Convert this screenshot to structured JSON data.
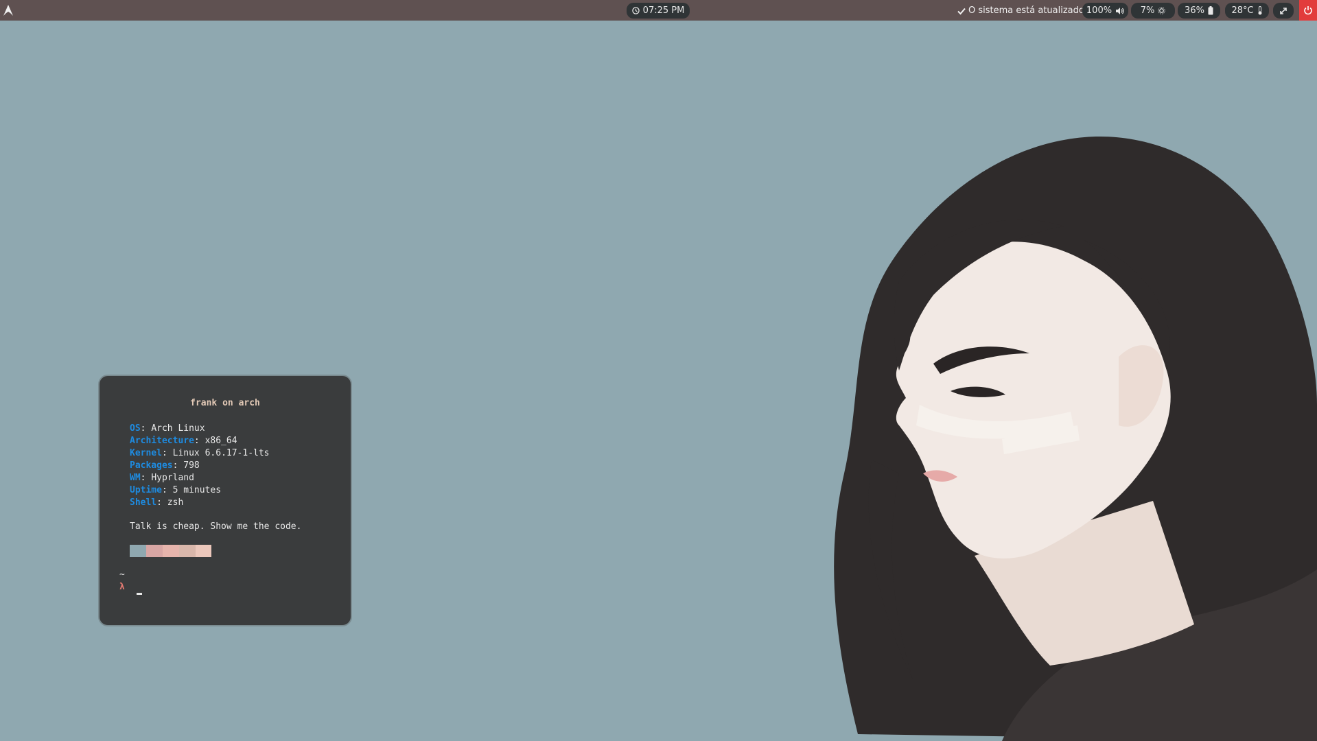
{
  "topbar": {
    "logo_icon": "arch-logo-icon",
    "clock": {
      "icon": "clock-icon",
      "time": "07:25 PM"
    },
    "update": {
      "icon": "check-icon",
      "text": "O sistema está atualizado!!!"
    },
    "volume": {
      "value": "100%",
      "icon": "speaker-icon"
    },
    "brightness": {
      "value": "7%",
      "icon": "brightness-icon"
    },
    "battery": {
      "value": "36%",
      "icon": "battery-icon"
    },
    "temperature": {
      "value": "28°C",
      "icon": "thermometer-icon"
    },
    "expand_icon": "expand-icon",
    "power_icon": "power-icon"
  },
  "terminal": {
    "title": "frank on arch",
    "info": [
      {
        "key": "OS",
        "value": "Arch Linux"
      },
      {
        "key": "Architecture",
        "value": "x86_64"
      },
      {
        "key": "Kernel",
        "value": "Linux 6.6.17-1-lts"
      },
      {
        "key": "Packages",
        "value": "798"
      },
      {
        "key": "WM",
        "value": "Hyprland"
      },
      {
        "key": "Uptime",
        "value": "5 minutes"
      },
      {
        "key": "Shell",
        "value": "zsh"
      }
    ],
    "quote": "Talk is cheap. Show me the code.",
    "palette": [
      "#8fa8b0",
      "#d8a6a4",
      "#e6b4ac",
      "#d9b7ab",
      "#ecc8bc"
    ],
    "prompt_dir": "~",
    "prompt_symbol": "λ"
  },
  "colors": {
    "desktop_bg": "#8fa8b0",
    "topbar_bg": "#5f5151",
    "pill_bg": "#2f3436",
    "power_bg": "#e23c3c",
    "terminal_bg": "#3a3c3d",
    "key_color": "#1e8be0"
  }
}
